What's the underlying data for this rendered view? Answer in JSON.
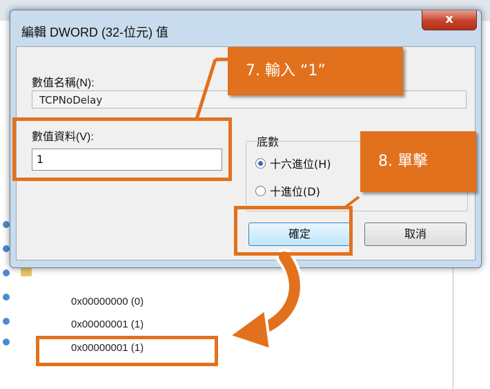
{
  "background": {
    "registry_values": [
      "0x00000000 (0)",
      "0x00000001 (1)",
      "0x00000001 (1)"
    ]
  },
  "dialog": {
    "title": "編輯 DWORD (32-位元) 值",
    "close_label": "x",
    "value_name_label": "數值名稱(N):",
    "value_name": "TCPNoDelay",
    "value_data_label": "數值資料(V):",
    "value_data": "1",
    "base_label": "底數",
    "radio_hex": "十六進位(H)",
    "radio_dec": "十進位(D)",
    "ok_label": "確定",
    "cancel_label": "取消"
  },
  "annotations": {
    "step7": "7.  輸入 “1”",
    "step8": "8.  單擊"
  },
  "colors": {
    "accent": "#e2711d",
    "dialog_frame": "#c9dced",
    "close_red": "#c7412a"
  }
}
